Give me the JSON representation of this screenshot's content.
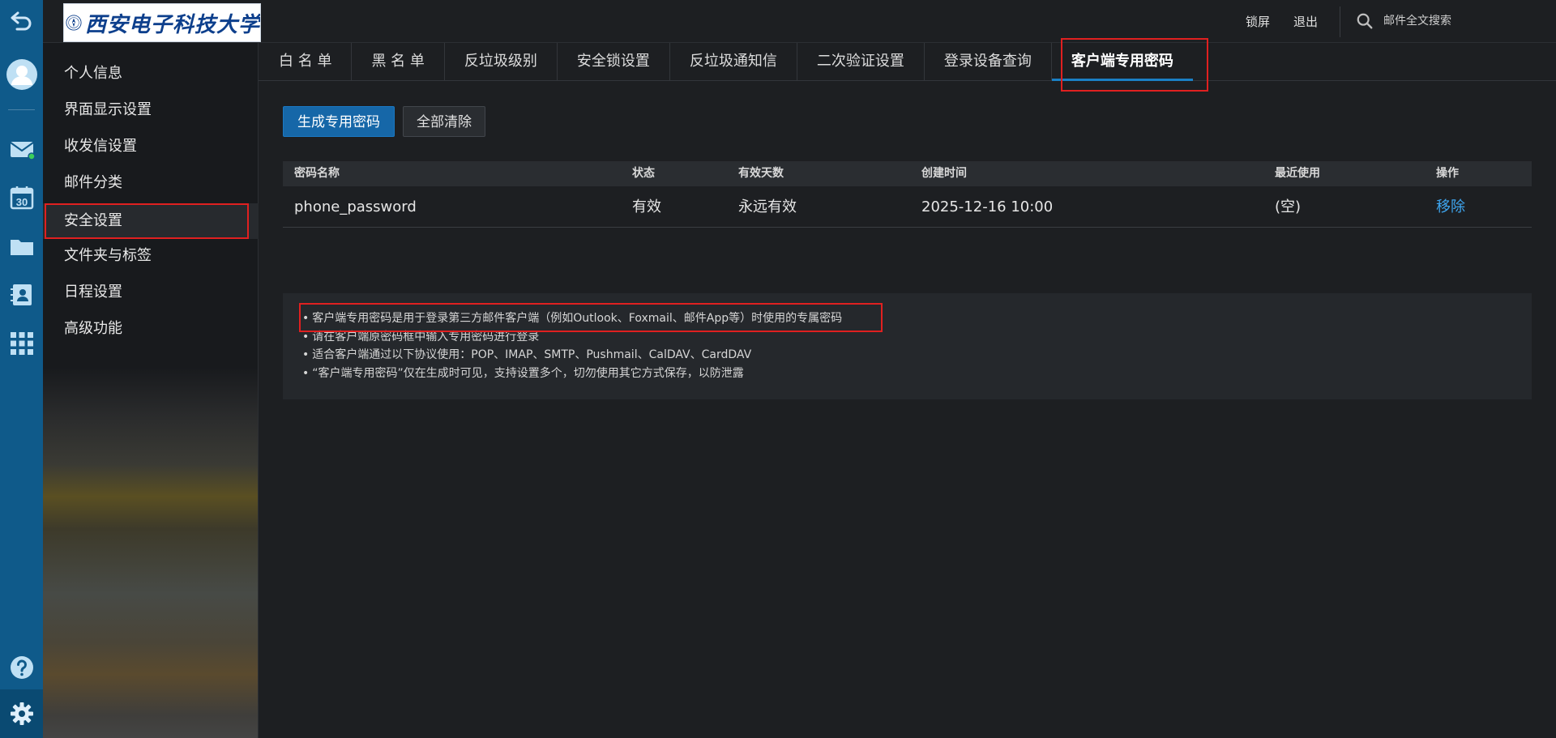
{
  "colors": {
    "rail": "#0f5a8a",
    "accent": "#1667a8",
    "link": "#3ea6f0",
    "highlight": "#e02020",
    "online_dot": "#3ccf5a"
  },
  "rail": {
    "icons": [
      "back-icon",
      "avatar",
      "mail-icon",
      "calendar-icon",
      "folder-icon",
      "contacts-icon",
      "apps-grid-icon",
      "help-icon",
      "gear-icon"
    ],
    "calendar_day": "30"
  },
  "header": {
    "logo_text": "西安电子科技大学",
    "lock_label": "锁屏",
    "logout_label": "退出",
    "search_placeholder": "邮件全文搜索"
  },
  "sidebar": {
    "items": [
      {
        "label": "个人信息"
      },
      {
        "label": "界面显示设置"
      },
      {
        "label": "收发信设置"
      },
      {
        "label": "邮件分类"
      },
      {
        "label": "安全设置"
      },
      {
        "label": "文件夹与标签"
      },
      {
        "label": "日程设置"
      },
      {
        "label": "高级功能"
      }
    ],
    "active_index": 4
  },
  "tabs": [
    {
      "label": "白 名 单"
    },
    {
      "label": "黑 名 单"
    },
    {
      "label": "反垃圾级别"
    },
    {
      "label": "安全锁设置"
    },
    {
      "label": "反垃圾通知信"
    },
    {
      "label": "二次验证设置"
    },
    {
      "label": "登录设备查询"
    },
    {
      "label": "客户端专用密码"
    }
  ],
  "active_tab_index": 7,
  "actions": {
    "generate_label": "生成专用密码",
    "clear_label": "全部清除"
  },
  "table": {
    "headers": {
      "name": "密码名称",
      "status": "状态",
      "valid_days": "有效天数",
      "created": "创建时间",
      "last_used": "最近使用",
      "operation": "操作"
    },
    "rows": [
      {
        "name": "phone_password",
        "status": "有效",
        "valid_days": "永远有效",
        "created": "2025-12-16 10:00",
        "last_used": "(空)",
        "operation": "移除"
      }
    ]
  },
  "notes": [
    "客户端专用密码是用于登录第三方邮件客户端（例如Outlook、Foxmail、邮件App等）时使用的专属密码",
    "请在客户端原密码框中输入专用密码进行登录",
    "适合客户端通过以下协议使用：POP、IMAP、SMTP、Pushmail、CalDAV、CardDAV",
    "“客户端专用密码”仅在生成时可见，支持设置多个，切勿使用其它方式保存，以防泄露"
  ],
  "note_bullet": "•"
}
